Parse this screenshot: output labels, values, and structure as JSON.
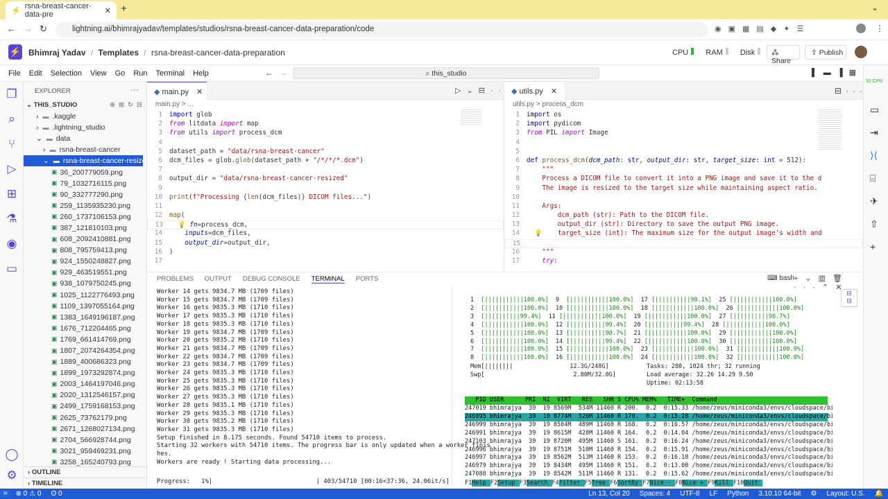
{
  "browser": {
    "tab_title": "rsna-breast-cancer-data-pre",
    "url": "lightning.ai/bhimrajyadav/templates/studios/rsna-breast-cancer-data-preparation/code"
  },
  "header": {
    "user": "Bhimraj Yadav",
    "sep1": "/",
    "templates": "Templates",
    "sep2": "/",
    "project": "rsna-breast-cancer-data-preparation",
    "cpu": "CPU",
    "ram": "RAM",
    "disk": "Disk",
    "share": "Share",
    "publish": "Publish"
  },
  "menu": {
    "file": "File",
    "edit": "Edit",
    "selection": "Selection",
    "view": "View",
    "go": "Go",
    "run": "Run",
    "terminal": "Terminal",
    "help": "Help",
    "search": "this_studio"
  },
  "explorer": {
    "title": "EXPLORER",
    "root": "THIS_STUDIO",
    "outline": "OUTLINE",
    "timeline": "TIMELINE",
    "folders": [
      ".kaggle",
      ".lightning_studio",
      "data",
      "rsna-breast-cancer",
      "rsna-breast-cancer-resize..."
    ],
    "files": [
      "36_200779059.png",
      "79_1032716115.png",
      "90_332777290.png",
      "259_1135935230.png",
      "260_1737106153.png",
      "387_121810103.png",
      "608_2092410881.png",
      "808_795759413.png",
      "924_1550248827.png",
      "929_463519551.png",
      "938_1079750245.png",
      "1025_1122776493.png",
      "1109_1397055164.png",
      "1383_1649196187.png",
      "1676_712204465.png",
      "1769_661414769.png",
      "1807_2074264354.png",
      "1889_400686323.png",
      "1899_1973292874.png",
      "2003_1464197046.png",
      "2020_1312546157.png",
      "2499_1759168153.png",
      "2625_73762179.png",
      "2671_1268027134.png",
      "2704_566928744.png",
      "3021_959469231.png",
      "3258_165240793.png"
    ]
  },
  "editor_left": {
    "tab": "main.py",
    "breadcrumb": "main.py > ..."
  },
  "editor_right": {
    "tab": "utils.py",
    "breadcrumb": "utils.py > process_dcm"
  },
  "panel": {
    "tabs": [
      "PROBLEMS",
      "OUTPUT",
      "DEBUG CONSOLE",
      "TERMINAL",
      "PORTS"
    ],
    "shell": "bash"
  },
  "terminal_left": [
    "Worker 14 gets 9834.7 MB (1709 files)",
    "Worker 15 gets 9834.7 MB (1709 files)",
    "Worker 16 gets 9835.3 MB (1710 files)",
    "Worker 17 gets 9835.3 MB (1710 files)",
    "Worker 18 gets 9835.3 MB (1710 files)",
    "Worker 19 gets 9834.7 MB (1709 files)",
    "Worker 20 gets 9835.2 MB (1710 files)",
    "Worker 21 gets 9834.7 MB (1709 files)",
    "Worker 22 gets 9834.7 MB (1709 files)",
    "Worker 23 gets 9834.7 MB (1709 files)",
    "Worker 24 gets 9835.3 MB (1710 files)",
    "Worker 25 gets 9835.3 MB (1710 files)",
    "Worker 26 gets 9835.3 MB (1710 files)",
    "Worker 27 gets 9835.3 MB (1710 files)",
    "Worker 28 gets 9835.1 MB (1710 files)",
    "Worker 29 gets 9835.3 MB (1710 files)",
    "Worker 30 gets 9835.2 MB (1710 files)",
    "Worker 31 gets 9835.3 MB (1710 files)",
    "Setup finished in 8.175 seconds. Found 54710 items to process.",
    "Starting 32 workers with 54710 items. The progress bar is only updated when a worker finis",
    "hes.",
    "Workers are ready ! Starting data processing..."
  ],
  "progress": {
    "label": "Progress:   1%|",
    "right": "| 403/54710 [00:16<37:36, 24.06it/s]",
    "percent": 1
  },
  "htop": {
    "cpus": [
      "1  [|||||||||||100.0%]  9  [|||||||||||100.0%]  17 [||||||||||98.1%]  25 [|||||||||||100.0%]",
      "2  [|||||||||||100.0%]  10 [|||||||||||100.0%]  18 [|||||||||||100.0%]  26 [|||||||||||100.0%]",
      "3  [||||||||||99.4%]  11 [|||||||||||100.0%]  19 [|||||||||||100.0%]  27 [||||||||||98.7%]",
      "4  [|||||||||||100.0%]  12 [||||||||||99.4%]  20 [||||||||||99.4%]  28 [|||||||||||100.0%]",
      "5  [|||||||||||100.0%]  13 [||||||||||98.7%]  21 [|||||||||||100.0%]  29 [|||||||||||100.0%]",
      "6  [|||||||||||100.0%]  14 [||||||||||99.4%]  22 [|||||||||||100.0%]  30 [|||||||||||100.0%]",
      "7  [|||||||||||100.0%]  15 [|||||||||||100.0%]  23 [|||||||||||100.0%]  31 [|||||||||||100.0%]",
      "8  [|||||||||||100.0%]  16 [|||||||||||100.0%]  24 [|||||||||||100.0%]  32 [|||||||||||100.0%]"
    ],
    "mem": "Mem[||||||||                12.3G/248G]",
    "swp": "Swp[                         2.80M/32.0G]",
    "tasks": "Tasks: 280, 1024 thr; 32 running",
    "load": "Load average: 32.26 14.29 9.50",
    "uptime": "Uptime: 02:13:58",
    "header": "   PID USER      PRI  NI  VIRT   RES   SHR S CPU% MEM%   TIME+  Command",
    "rows": [
      "247019 bhimrajya  39  19 8569M  534M 11460 R 200.  0.2  0:15.33 /home/zeus/miniconda3/envs/cloudspace/bin/pytho",
      "246995 bhimrajya  39  19 8774M  526M 11460 R 170.  0.2  0:15.28 /home/zeus/miniconda3/envs/cloudspace/bin/pytho",
      "246999 bhimrajya  39  19 8504M  489M 11460 R 168.  0.2  0:16.57 /home/zeus/miniconda3/envs/cloudspace/bin/pytho",
      "246991 bhimrajya  39  19 8615M  428M 11460 R 164.  0.2  0:14.04 /home/zeus/miniconda3/envs/cloudspace/bin/pytho",
      "247103 bhimrajya  39  19 8720M  495M 11460 S 161.  0.2  0:16.24 /home/zeus/miniconda3/envs/cloudspace/bin/pytho",
      "246996 bhimrajya  39  19 8751M  510M 11460 R 154.  0.2  0:15.91 /home/zeus/miniconda3/envs/cloudspace/bin/pytho",
      "246997 bhimrajya  39  19 8562M  513M 11460 R 153.  0.2  0:16.18 /home/zeus/miniconda3/envs/cloudspace/bin/pytho",
      "246979 bhimrajya  39  19 8434M  495M 11460 R 151.  0.2  0:13.00 /home/zeus/miniconda3/envs/cloudspace/bin/pytho",
      "247088 bhimrajya  39  19 8542M  511M 11460 R 131.  0.2  0:15.62 /home/zeus/miniconda3/envs/cloudspace/bin/pytho"
    ],
    "fkeys": [
      [
        "F1",
        "Help"
      ],
      [
        "F2",
        "Setup"
      ],
      [
        "F3",
        "Search"
      ],
      [
        "F4",
        "Filter"
      ],
      [
        "F5",
        "Tree"
      ],
      [
        "F6",
        "SortBy"
      ],
      [
        "F7",
        "Nice -"
      ],
      [
        "F8",
        "Nice +"
      ],
      [
        "F9",
        "Kill"
      ],
      [
        "F10",
        "Quit"
      ]
    ]
  },
  "statusbar": {
    "remote": "⊗ 0 ⚠ 0",
    "ports": "ʘ 0",
    "pos": "Ln 13, Col 20",
    "spaces": "Spaces: 4",
    "enc": "UTF-8",
    "eol": "LF",
    "lang": "Python",
    "ver": "3.10.10 64-bit",
    "layout": "Layout: U.S."
  },
  "right_badge": "32 CPU"
}
